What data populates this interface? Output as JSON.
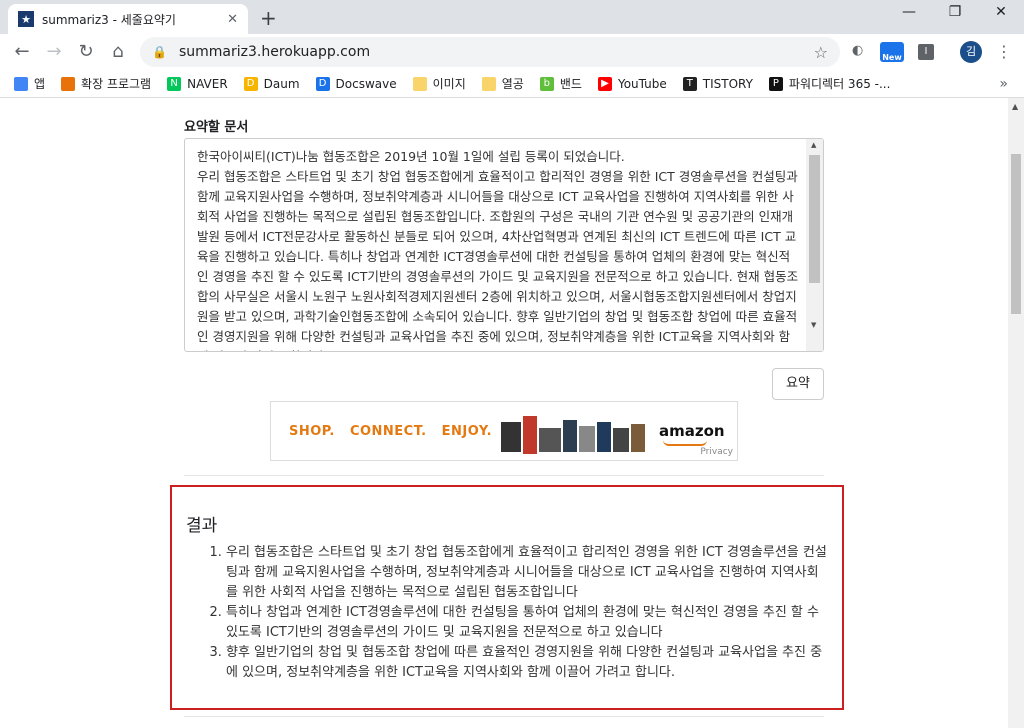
{
  "browser": {
    "tab_title": "summariz3 - 세줄요약기",
    "tab_favicon": "★",
    "url": "summariz3.herokuapp.com",
    "ext_new_label": "New",
    "ext_i_label": "I",
    "avatar_label": "김"
  },
  "bookmarks": [
    {
      "label": "앱",
      "icon": "apps-grid-icon",
      "color": "#4285f4"
    },
    {
      "label": "확장 프로그램",
      "icon": "extensions-icon",
      "color": "#e8710a"
    },
    {
      "label": "NAVER",
      "icon": "naver-icon",
      "color": "#03c75a",
      "glyph": "N"
    },
    {
      "label": "Daum",
      "icon": "daum-icon",
      "color": "#f7b500",
      "glyph": "D"
    },
    {
      "label": "Docswave",
      "icon": "docswave-icon",
      "color": "#1a73e8",
      "glyph": "D"
    },
    {
      "label": "이미지",
      "icon": "folder-icon",
      "color": "#f9d46b"
    },
    {
      "label": "열공",
      "icon": "folder-icon",
      "color": "#f9d46b"
    },
    {
      "label": "밴드",
      "icon": "band-icon",
      "color": "#5fbf3a",
      "glyph": "b"
    },
    {
      "label": "YouTube",
      "icon": "youtube-icon",
      "color": "#ff0000",
      "glyph": "▶"
    },
    {
      "label": "TISTORY",
      "icon": "tistory-icon",
      "color": "#222222",
      "glyph": "T"
    },
    {
      "label": "파워디렉터 365 -...",
      "icon": "powerdirector-icon",
      "color": "#111111",
      "glyph": "P"
    }
  ],
  "form": {
    "label": "요약할 문서",
    "document_text": "한국아이씨티(ICT)나눔 협동조합은 2019년 10월 1일에 설립 등록이 되었습니다.\n우리 협동조합은 스타트업 및 초기 창업 협동조합에게 효율적이고 합리적인 경영을 위한 ICT 경영솔루션을 컨설팅과 함께 교육지원사업을 수행하며, 정보취약계층과 시니어들을 대상으로 ICT 교육사업을 진행하여 지역사회를 위한 사회적 사업을 진행하는 목적으로 설립된 협동조합입니다. 조합원의 구성은 국내의 기관 연수원 및 공공기관의 인재개발원 등에서 ICT전문강사로 활동하신 분들로 되어 있으며, 4차산업혁명과 연계된 최신의 ICT 트렌드에 따른 ICT 교육을 진행하고 있습니다. 특히나 창업과 연계한 ICT경영솔루션에 대한 컨설팅을 통하여 업체의 환경에 맞는 혁신적인 경영을 추진 할 수 있도록 ICT기반의 경영솔루션의 가이드 및 교육지원을 전문적으로 하고 있습니다. 현재 협동조합의 사무실은 서울시 노원구 노원사회적경제지원센터 2층에 위치하고 있으며, 서울시협동조합지원센터에서 창업지원을 받고 있으며, 과학기술인협동조합에 소속되어 있습니다. 향후 일반기업의 창업 및 협동조합 창업에 따른 효율적인 경영지원을 위해 다양한 컨설팅과 교육사업을 추진 중에 있으며, 정보취약계층을 위한 ICT교육을 지역사회와 함께 이끌어 가려고 합니다.",
    "submit_label": "요약"
  },
  "ad": {
    "slogan": "SHOP.   CONNECT.   ENJOY.",
    "brand": "amazon",
    "privacy": "Privacy"
  },
  "result": {
    "heading": "결과",
    "items": [
      "우리 협동조합은 스타트업 및 초기 창업 협동조합에게 효율적이고 합리적인 경영을 위한 ICT 경영솔루션을 컨설팅과 함께 교육지원사업을 수행하며, 정보취약계층과 시니어들을 대상으로 ICT 교육사업을 진행하여 지역사회를 위한 사회적 사업을 진행하는 목적으로 설립된 협동조합입니다",
      "특히나 창업과 연계한 ICT경영솔루션에 대한 컨설팅을 통하여 업체의 환경에 맞는 혁신적인 경영을 추진 할 수 있도록 ICT기반의 경영솔루션의 가이드 및 교육지원을 전문적으로 하고 있습니다",
      "향후 일반기업의 창업 및 협동조합 창업에 따른 효율적인 경영지원을 위해 다양한 컨설팅과 교육사업을 추진 중에 있으며, 정보취약계층을 위한 ICT교육을 지역사회와 함께 이끌어 가려고 합니다."
    ]
  }
}
